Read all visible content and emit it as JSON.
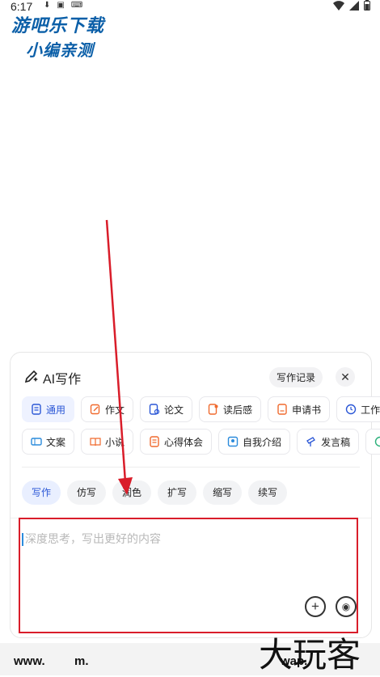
{
  "status_bar": {
    "time": "6:17"
  },
  "watermark_top": {
    "line1": "游吧乐下载",
    "line2": "小编亲测"
  },
  "panel": {
    "title": "AI写作",
    "history_button": "写作记录",
    "row1_chips": [
      {
        "label": "通用",
        "active": true
      },
      {
        "label": "作文"
      },
      {
        "label": "论文"
      },
      {
        "label": "读后感"
      },
      {
        "label": "申请书"
      },
      {
        "label": "工作"
      }
    ],
    "row2_chips": [
      {
        "label": "文案"
      },
      {
        "label": "小说"
      },
      {
        "label": "心得体会"
      },
      {
        "label": "自我介绍"
      },
      {
        "label": "发言稿"
      }
    ],
    "tabs": [
      {
        "label": "写作",
        "active": true
      },
      {
        "label": "仿写"
      },
      {
        "label": "润色"
      },
      {
        "label": "扩写"
      },
      {
        "label": "缩写"
      },
      {
        "label": "续写"
      }
    ],
    "input_placeholder": "深度思考，写出更好的内容"
  },
  "bottom_bar": {
    "left": "www.",
    "middle": "m.",
    "wap": "wap.",
    "logo": "大玩客"
  },
  "colors": {
    "accent": "#2b57d6",
    "annotation_red": "#d91d2a"
  }
}
